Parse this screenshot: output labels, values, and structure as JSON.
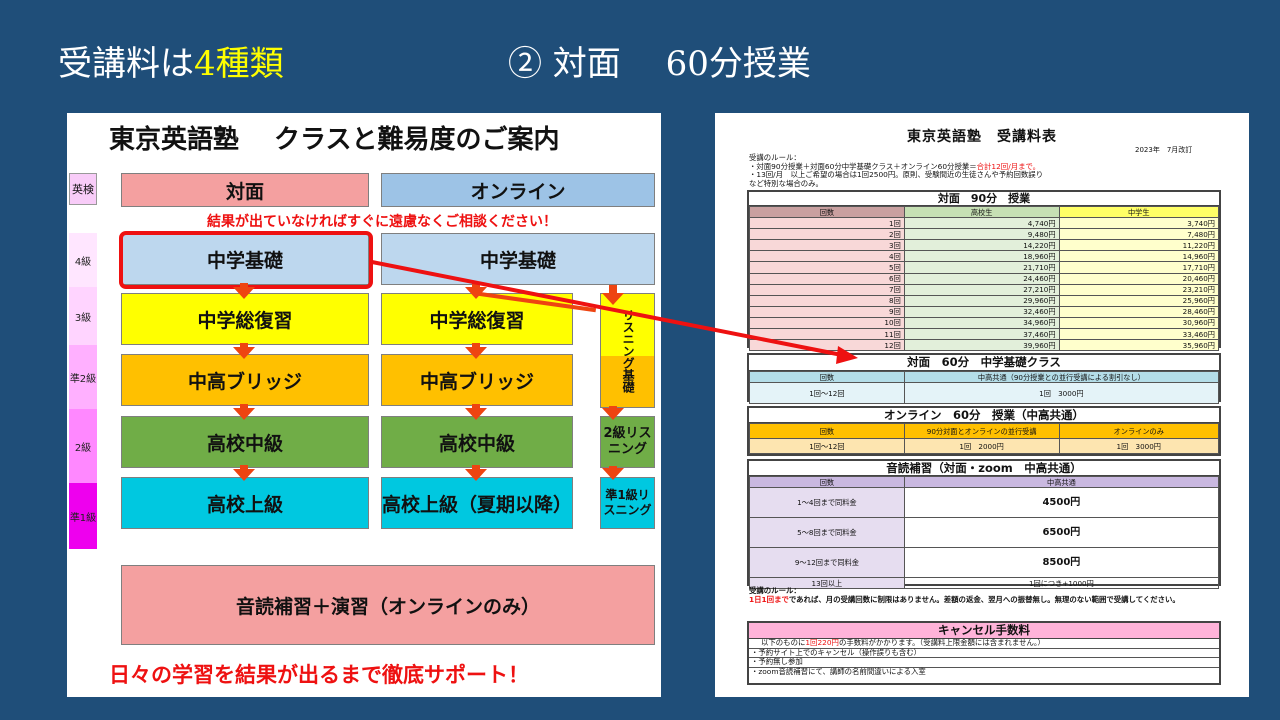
{
  "header": {
    "title_prefix": "受講料は",
    "title_highlight": "4種類",
    "subtitle": "② 対面　 60分授業"
  },
  "left_panel": {
    "title": "東京英語塾　 クラスと難易度のご案内",
    "eiken_label": "英検",
    "levels": [
      "4級",
      "3級",
      "準2級",
      "2級",
      "準1級"
    ],
    "col_inperson": "対面",
    "col_online": "オンライン",
    "consult_note": "結果が出ていなければすぐに遠慮なくご相談ください！",
    "inperson": [
      "中学基礎",
      "中学総復習",
      "中高ブリッジ",
      "高校中級",
      "高校上級"
    ],
    "online": [
      "中学基礎",
      "中学総復習",
      "中高ブリッジ",
      "高校中級",
      "高校上級（夏期以降）"
    ],
    "listening_basic": "リスニング基礎",
    "listening_2": "2級リスニング",
    "listening_pre1": "準1級リスニング",
    "ondoku": "音読補習＋演習（オンラインのみ）",
    "support": "日々の学習を結果が出るまで徹底サポート！",
    "colors": {
      "inperson_header": "#f4a0a0",
      "online_header": "#9dc3e6",
      "basic": "#bdd7ee",
      "review": "#ffff00",
      "bridge": "#ffc000",
      "mid": "#70ad47",
      "upper": "#00c8e0",
      "listening_top": "#ffff00",
      "listening_bottom": "#ffc000",
      "arrow": "#ee4411",
      "highlight": "#ee1111"
    }
  },
  "fee_sheet": {
    "title": "東京英語塾　受講料表",
    "date": "2023年　7月改訂",
    "rules_heading": "受講のルール：",
    "rule_1_prefix": "・対面90分授業＋対面60分中学基礎クラス＋オンライン60分授業＝",
    "rule_1_red": "合計12回/月まで。",
    "rule_2": "・13回/月　以上ご希望の場合は1回2500円。原則、受験間近の生徒さんや予約回数誤り",
    "rule_3": "など特別な場合のみ。",
    "s90": {
      "title": "対面　90分　授業",
      "headers": [
        "回数",
        "高校生",
        "中学生"
      ],
      "rows": [
        [
          "1回",
          "4,740円",
          "3,740円"
        ],
        [
          "2回",
          "9,480円",
          "7,480円"
        ],
        [
          "3回",
          "14,220円",
          "11,220円"
        ],
        [
          "4回",
          "18,960円",
          "14,960円"
        ],
        [
          "5回",
          "21,710円",
          "17,710円"
        ],
        [
          "6回",
          "24,460円",
          "20,460円"
        ],
        [
          "7回",
          "27,210円",
          "23,210円"
        ],
        [
          "8回",
          "29,960円",
          "25,960円"
        ],
        [
          "9回",
          "32,460円",
          "28,460円"
        ],
        [
          "10回",
          "34,960円",
          "30,960円"
        ],
        [
          "11回",
          "37,460円",
          "33,460円"
        ],
        [
          "12回",
          "39,960円",
          "35,960円"
        ]
      ]
    },
    "s60": {
      "title": "対面　60分　中学基礎クラス",
      "headers": [
        "回数",
        "中高共通（90分授業との並行受講による割引なし）"
      ],
      "row": [
        "1回〜12回",
        "1回　3000円"
      ]
    },
    "online": {
      "title": "オンライン　60分　授業（中高共通）",
      "headers": [
        "回数",
        "90分対面とオンラインの並行受講",
        "オンラインのみ"
      ],
      "row": [
        "1回〜12回",
        "1回　2000円",
        "1回　3000円"
      ]
    },
    "ondoku": {
      "title": "音読補習（対面・zoom　中高共通）",
      "headers": [
        "回数",
        "中高共通"
      ],
      "rows": [
        [
          "1〜4回まで同料金",
          "4500円"
        ],
        [
          "5〜8回まで同料金",
          "6500円"
        ],
        [
          "9〜12回まで同料金",
          "8500円"
        ],
        [
          "13回以上",
          "1回につき+1000円"
        ]
      ]
    },
    "rules2_heading": "受講のルール：",
    "rules2_red": "1日1回まで",
    "rules2_text": "であれば、月の受講回数に制限はありません。差額の返金、翌月への振替無し。無理のない範囲で受講してください。",
    "cancel": {
      "title": "キャンセル手数料",
      "line_prefix": "以下のものに",
      "line_red": "1回220円",
      "line_suffix": "の手数料がかかります。（受講料上限金額には含まれません。）",
      "items": [
        "・予約サイト上でのキャンセル（操作誤りも含む）",
        "・予約無し参加",
        "・zoom音読補習にて、講師の名前間違いによる入室"
      ]
    }
  }
}
